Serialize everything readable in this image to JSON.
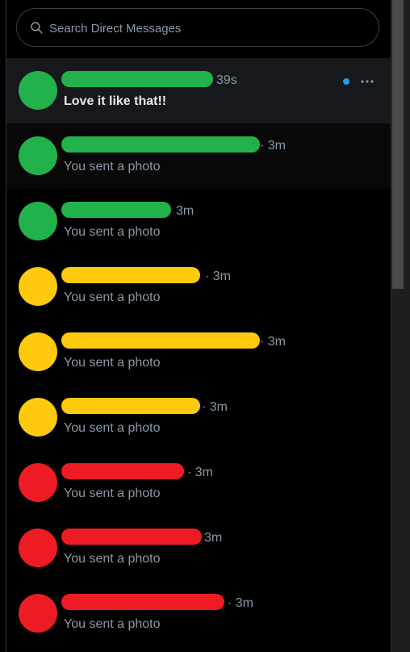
{
  "search": {
    "placeholder": "Search Direct Messages"
  },
  "conversations": [
    {
      "time": "39s",
      "preview": "Love it like that!!",
      "unread": true,
      "avatar_color": "#22b24c",
      "redaction_color": "#22b24c"
    },
    {
      "time": "· 3m",
      "preview": "You sent a photo",
      "unread": false,
      "avatar_color": "#22b24c",
      "redaction_color": "#22b24c"
    },
    {
      "time": "3m",
      "preview": "You sent a photo",
      "unread": false,
      "avatar_color": "#22b24c",
      "redaction_color": "#22b24c"
    },
    {
      "time": "· 3m",
      "preview": "You sent a photo",
      "unread": false,
      "avatar_color": "#ffc90e",
      "redaction_color": "#ffc90e"
    },
    {
      "time": "· 3m",
      "preview": "You sent a photo",
      "unread": false,
      "avatar_color": "#ffc90e",
      "redaction_color": "#ffc90e"
    },
    {
      "time": "· 3m",
      "preview": "You sent a photo",
      "unread": false,
      "avatar_color": "#ffc90e",
      "redaction_color": "#ffc90e"
    },
    {
      "time": "· 3m",
      "preview": "You sent a photo",
      "unread": false,
      "avatar_color": "#ed1c24",
      "redaction_color": "#ed1c24"
    },
    {
      "time": "3m",
      "preview": "You sent a photo",
      "unread": false,
      "avatar_color": "#ed1c24",
      "redaction_color": "#ed1c24"
    },
    {
      "time": "· 3m",
      "preview": "You sent a photo",
      "unread": false,
      "avatar_color": "#ed1c24",
      "redaction_color": "#ed1c24"
    }
  ],
  "icons": {
    "search": "search-icon",
    "more": "more-icon"
  },
  "colors": {
    "unread_dot": "#1d9bf0",
    "selected_bg": "#16181c"
  }
}
